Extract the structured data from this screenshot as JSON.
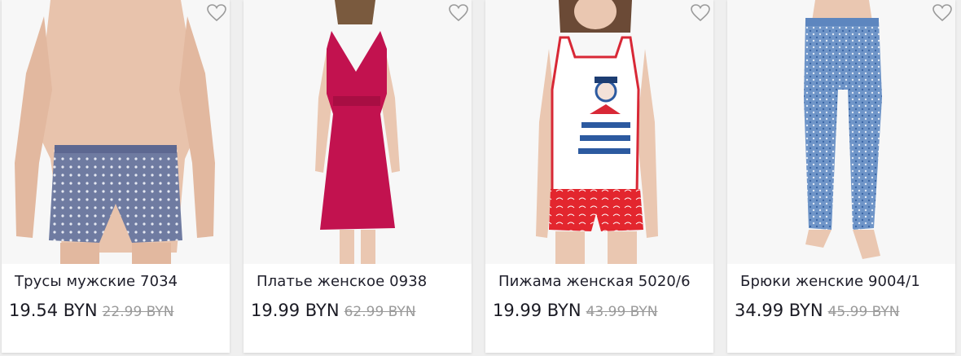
{
  "colors": {
    "background": "#efefef",
    "card": "#ffffff",
    "text": "#1e1e2a",
    "old_price": "#9a9a9a",
    "heart_outline": "#9a9a9a"
  },
  "products": [
    {
      "title": "Трусы мужские 7034",
      "price": "19.54 BYN",
      "old_price": "22.99 BYN",
      "icon": "heart-outline-icon"
    },
    {
      "title": "Платье женское 0938",
      "price": "19.99 BYN",
      "old_price": "62.99 BYN",
      "icon": "heart-outline-icon"
    },
    {
      "title": "Пижама женская 5020/6",
      "price": "19.99 BYN",
      "old_price": "43.99 BYN",
      "icon": "heart-outline-icon"
    },
    {
      "title": "Брюки женские 9004/1",
      "price": "34.99 BYN",
      "old_price": "45.99 BYN",
      "icon": "heart-outline-icon"
    }
  ]
}
